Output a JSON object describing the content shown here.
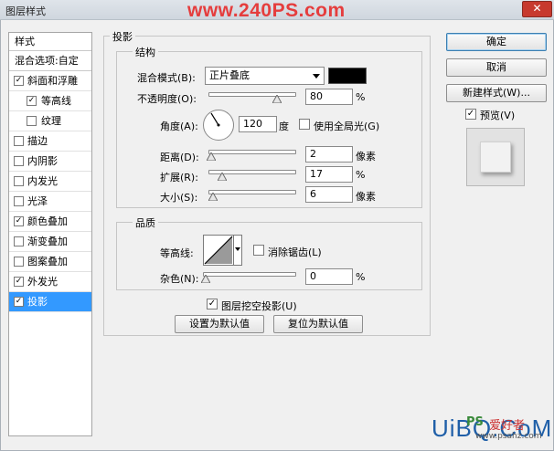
{
  "window": {
    "title": "图层样式",
    "watermark": "www.240PS.com",
    "close_label": "✕"
  },
  "style_list": {
    "header": "样式",
    "blend_options": "混合选项:自定",
    "items": [
      {
        "label": "斜面和浮雕",
        "checked": true
      },
      {
        "label": "等高线",
        "checked": true,
        "sub": true
      },
      {
        "label": "纹理",
        "checked": false,
        "sub": true
      },
      {
        "label": "描边",
        "checked": false
      },
      {
        "label": "内阴影",
        "checked": false
      },
      {
        "label": "内发光",
        "checked": false
      },
      {
        "label": "光泽",
        "checked": false
      },
      {
        "label": "颜色叠加",
        "checked": true
      },
      {
        "label": "渐变叠加",
        "checked": false
      },
      {
        "label": "图案叠加",
        "checked": false
      },
      {
        "label": "外发光",
        "checked": true
      },
      {
        "label": "投影",
        "checked": true,
        "selected": true
      }
    ]
  },
  "panel": {
    "title": "投影",
    "structure": {
      "title": "结构",
      "blend_mode_label": "混合模式(B):",
      "blend_mode_value": "正片叠底",
      "swatch_color": "#000000",
      "opacity_label": "不透明度(O):",
      "opacity_value": "80",
      "opacity_unit": "%",
      "angle_label": "角度(A):",
      "angle_value": "120",
      "angle_unit": "度",
      "global_light_label": "使用全局光(G)",
      "distance_label": "距离(D):",
      "distance_value": "2",
      "distance_unit": "像素",
      "spread_label": "扩展(R):",
      "spread_value": "17",
      "spread_unit": "%",
      "size_label": "大小(S):",
      "size_value": "6",
      "size_unit": "像素"
    },
    "quality": {
      "title": "品质",
      "contour_label": "等高线:",
      "antialias_label": "消除锯齿(L)",
      "noise_label": "杂色(N):",
      "noise_value": "0",
      "noise_unit": "%"
    },
    "knockout_label": "图层挖空投影(U)",
    "make_default_label": "设置为默认值",
    "reset_default_label": "复位为默认值"
  },
  "right": {
    "ok_label": "确定",
    "cancel_label": "取消",
    "new_style_label": "新建样式(W)...",
    "preview_label": "预览(V)"
  },
  "footer_logo": {
    "main": "UiBQ.CoM",
    "ps": "PS",
    "cn": "爱好者",
    "url": "www.psahz.com"
  }
}
